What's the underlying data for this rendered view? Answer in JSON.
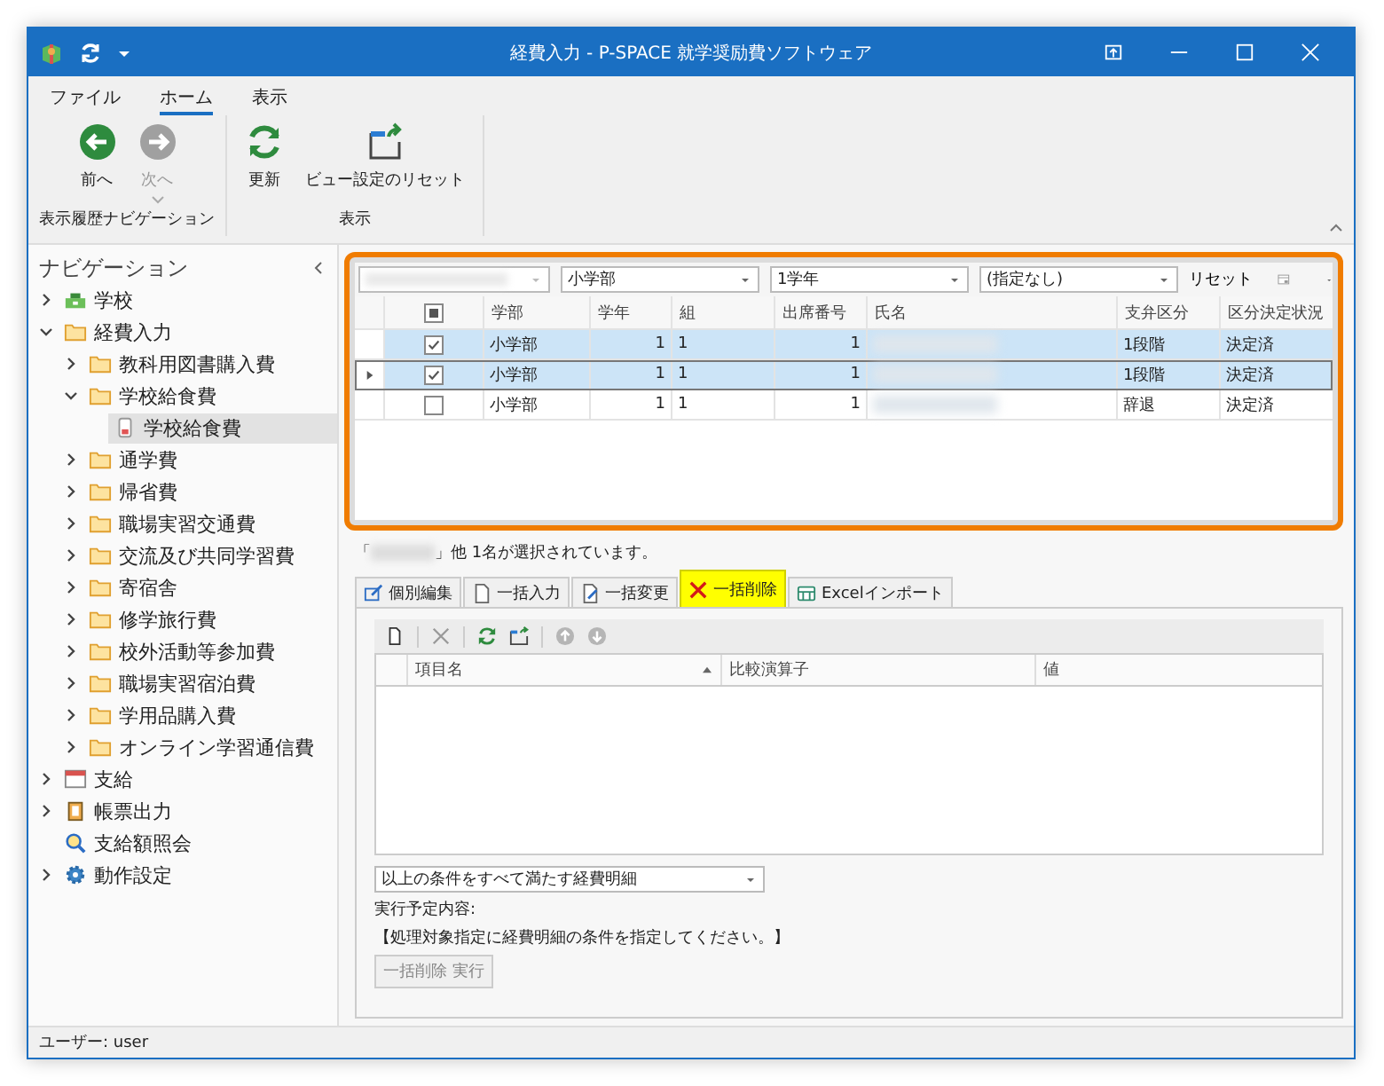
{
  "window": {
    "title": "経費入力 - P-SPACE 就学奨励費ソフトウェア"
  },
  "ribbon": {
    "tabs": [
      {
        "label": "ファイル",
        "selected": false
      },
      {
        "label": "ホーム",
        "selected": true
      },
      {
        "label": "表示",
        "selected": false
      }
    ],
    "groups": [
      {
        "label": "表示履歴ナビゲーション",
        "buttons": [
          {
            "label": "前へ",
            "kind": "back",
            "disabled": false
          },
          {
            "label": "次へ",
            "kind": "forward",
            "disabled": true
          }
        ]
      },
      {
        "label": "表示",
        "buttons": [
          {
            "label": "更新",
            "kind": "refresh",
            "disabled": false
          },
          {
            "label": "ビュー設定のリセット",
            "kind": "reset",
            "disabled": false
          }
        ]
      }
    ]
  },
  "navigation": {
    "title": "ナビゲーション",
    "items": [
      {
        "label": "学校",
        "kind": "school",
        "expandable": true,
        "expanded": false,
        "selected": false
      },
      {
        "label": "経費入力",
        "kind": "folder",
        "expandable": true,
        "expanded": true,
        "selected": false,
        "children": [
          {
            "label": "教科用図書購入費",
            "kind": "folder",
            "expandable": true,
            "expanded": false,
            "selected": false
          },
          {
            "label": "学校給食費",
            "kind": "folder",
            "expandable": true,
            "expanded": true,
            "selected": false,
            "children": [
              {
                "label": "学校給食費",
                "kind": "form",
                "expandable": false,
                "selected": true
              }
            ]
          },
          {
            "label": "通学費",
            "kind": "folder",
            "expandable": true,
            "expanded": false,
            "selected": false
          },
          {
            "label": "帰省費",
            "kind": "folder",
            "expandable": true,
            "expanded": false,
            "selected": false
          },
          {
            "label": "職場実習交通費",
            "kind": "folder",
            "expandable": true,
            "expanded": false,
            "selected": false
          },
          {
            "label": "交流及び共同学習費",
            "kind": "folder",
            "expandable": true,
            "expanded": false,
            "selected": false
          },
          {
            "label": "寄宿舎",
            "kind": "folder",
            "expandable": true,
            "expanded": false,
            "selected": false
          },
          {
            "label": "修学旅行費",
            "kind": "folder",
            "expandable": true,
            "expanded": false,
            "selected": false
          },
          {
            "label": "校外活動等参加費",
            "kind": "folder",
            "expandable": true,
            "expanded": false,
            "selected": false
          },
          {
            "label": "職場実習宿泊費",
            "kind": "folder",
            "expandable": true,
            "expanded": false,
            "selected": false
          },
          {
            "label": "学用品購入費",
            "kind": "folder",
            "expandable": true,
            "expanded": false,
            "selected": false
          },
          {
            "label": "オンライン学習通信費",
            "kind": "folder",
            "expandable": true,
            "expanded": false,
            "selected": false
          }
        ]
      },
      {
        "label": "支給",
        "kind": "calendar",
        "expandable": true,
        "expanded": false,
        "selected": false
      },
      {
        "label": "帳票出力",
        "kind": "report",
        "expandable": true,
        "expanded": false,
        "selected": false
      },
      {
        "label": "支給額照会",
        "kind": "search",
        "expandable": false,
        "selected": false
      },
      {
        "label": "動作設定",
        "kind": "settings",
        "expandable": true,
        "expanded": false,
        "selected": false
      }
    ]
  },
  "filters": [
    {
      "kind": "redacted"
    },
    {
      "kind": "combo",
      "value": "小学部"
    },
    {
      "kind": "combo",
      "value": "1学年"
    },
    {
      "kind": "combo",
      "value": "(指定なし)"
    }
  ],
  "filter_reset": "リセット",
  "grid": {
    "header_indeterminate": true,
    "columns": [
      {
        "label": "学部",
        "kind": "text"
      },
      {
        "label": "学年",
        "kind": "number"
      },
      {
        "label": "組",
        "kind": "text"
      },
      {
        "label": "出席番号",
        "kind": "number"
      },
      {
        "label": "氏名",
        "kind": "redacted"
      },
      {
        "label": "支弁区分",
        "kind": "text"
      },
      {
        "label": "区分決定状況",
        "kind": "text"
      }
    ],
    "rows": [
      {
        "checked": true,
        "selected": true,
        "current": false,
        "cells": [
          "小学部",
          "1",
          "1",
          "1",
          "",
          "1段階",
          "決定済"
        ]
      },
      {
        "checked": true,
        "selected": true,
        "current": true,
        "cells": [
          "小学部",
          "1",
          "1",
          "1",
          "",
          "1段階",
          "決定済"
        ]
      },
      {
        "checked": false,
        "selected": false,
        "current": false,
        "cells": [
          "小学部",
          "1",
          "1",
          "1",
          "",
          "辞退",
          "決定済"
        ]
      }
    ]
  },
  "selection": {
    "prefix": "「",
    "suffix": "」他 1名が選択されています。"
  },
  "edit_tabs": [
    {
      "label": "個別編集",
      "kind": "edit",
      "selected": false
    },
    {
      "label": "一括入力",
      "kind": "page",
      "selected": false
    },
    {
      "label": "一括変更",
      "kind": "page-edit",
      "selected": false
    },
    {
      "label": "一括削除",
      "kind": "delete",
      "selected": true
    },
    {
      "label": "Excelインポート",
      "kind": "import",
      "selected": false
    }
  ],
  "conditions": {
    "toolbar": [
      {
        "kind": "new",
        "disabled": false
      },
      {
        "kind": "delete",
        "disabled": true
      },
      {
        "kind": "refresh",
        "disabled": false
      },
      {
        "kind": "reset",
        "disabled": false
      },
      {
        "kind": "up",
        "disabled": true
      },
      {
        "kind": "down",
        "disabled": true
      }
    ],
    "columns": [
      {
        "label": "項目名",
        "sorted": true
      },
      {
        "label": "比較演算子",
        "sorted": false
      },
      {
        "label": "値",
        "sorted": false
      }
    ],
    "match": "以上の条件をすべて満たす経費明細",
    "plan_label": "実行予定内容:",
    "plan_message": "【処理対象指定に経費明細の条件を指定してください。】",
    "execute": {
      "label": "一括削除 実行",
      "disabled": true
    }
  },
  "status_bar": "ユーザー: user"
}
